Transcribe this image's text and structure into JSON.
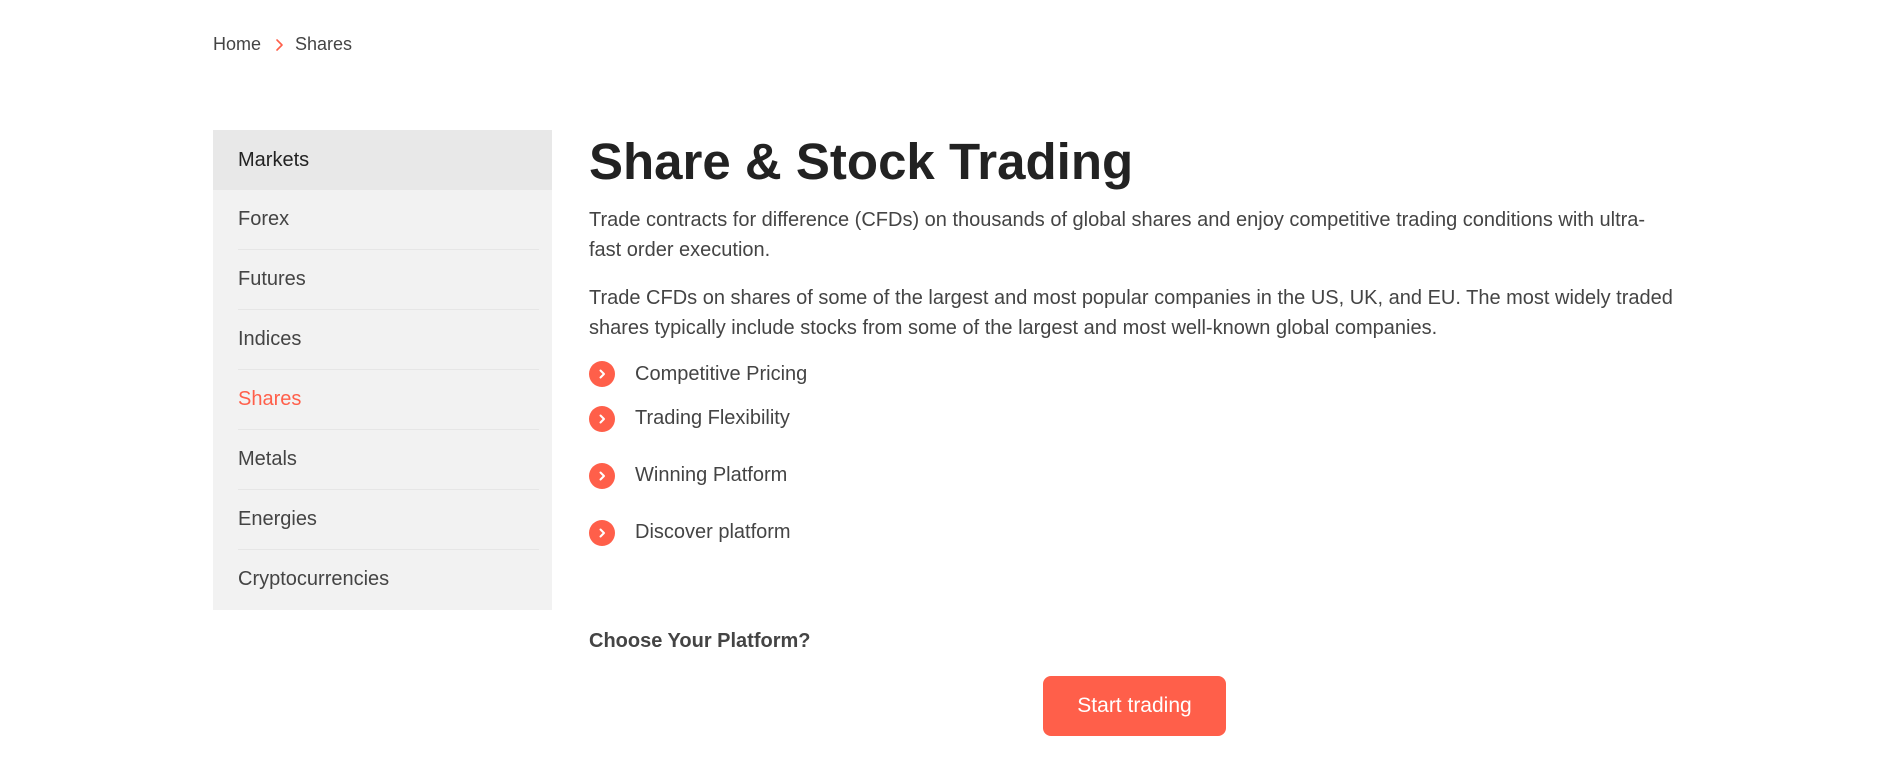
{
  "breadcrumb": {
    "home": "Home",
    "current": "Shares",
    "separator_icon": "chevron-right-icon"
  },
  "sidebar": {
    "heading": "Markets",
    "items": [
      {
        "label": "Forex"
      },
      {
        "label": "Futures"
      },
      {
        "label": "Indices"
      },
      {
        "label": "Shares",
        "active": true
      },
      {
        "label": "Metals"
      },
      {
        "label": "Energies"
      },
      {
        "label": "Cryptocurrencies"
      }
    ]
  },
  "main": {
    "title": "Share & Stock Trading",
    "paragraphs": [
      "Trade contracts for difference (CFDs) on thousands of global shares and enjoy competitive trading conditions with ultra-fast order execution.",
      "Trade CFDs on shares of some of the largest and most popular companies in the US, UK, and EU. The most widely traded shares typically include stocks from some of the largest and most well-known global companies."
    ],
    "features": [
      {
        "label": "Competitive Pricing",
        "icon": "chevron-circle-icon"
      },
      {
        "label": "Trading Flexibility",
        "icon": "chevron-circle-icon"
      },
      {
        "label": "Winning Platform",
        "icon": "chevron-circle-icon"
      },
      {
        "label": "Discover platform",
        "icon": "chevron-circle-icon"
      }
    ],
    "choose_label": "Choose Your Platform?",
    "cta_label": "Start trading"
  },
  "colors": {
    "accent": "#ff5f4a",
    "sidebar_bg": "#f2f2f2",
    "sidebar_head_bg": "#e8e8e8",
    "text": "#444444",
    "title": "#222222"
  }
}
